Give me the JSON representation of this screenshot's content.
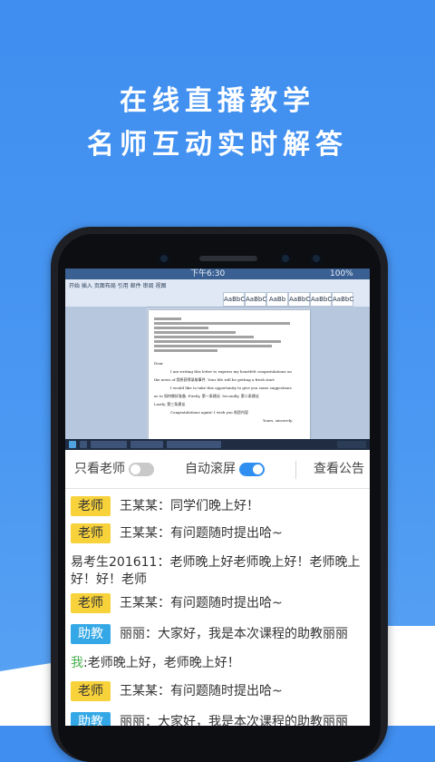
{
  "headline": {
    "line1": "在线直播教学",
    "line2": "名师互动实时解答"
  },
  "video": {
    "status_time": "下午6:30",
    "status_battery": "100%",
    "ribbon_tabs": "开始  插入  页面布局  引用  邮件  审阅  视图",
    "styles": [
      "AaBbCcI",
      "AaBbCcI",
      "AaBb",
      "AaBbC",
      "AaBbC",
      "AaBbC"
    ],
    "doc_text": {
      "dear": "Dear",
      "p1": "I am writing this letter to express my heartfelt congratulations on",
      "p2": "the news of 我所获得录取事件. Your life will be getting a fresh start",
      "p3": "I would like to take this opportunity to give you some suggestions",
      "p4": "as to 如何做好准备. Firstly, 第一条建议. Secondly, 第二条建议",
      "p5": "Lastly, 第三条建议.",
      "p6": "Congratulations again! I wish you 祝愿内容",
      "sign": "Yours, sincerely,"
    }
  },
  "controls": {
    "teacher_only_label": "只看老师",
    "teacher_only_on": false,
    "autoscroll_label": "自动滚屏",
    "autoscroll_on": true,
    "notice_label": "查看公告"
  },
  "chat": {
    "messages": [
      {
        "badge": "老师",
        "badge_type": "teacher",
        "text": "王某某：同学们晚上好！"
      },
      {
        "badge": "老师",
        "badge_type": "teacher",
        "text": "王某某：有问题随时提出哈~"
      },
      {
        "badge": "",
        "badge_type": "none",
        "text": "易考生201611：老师晚上好老师晚上好！老师晚上好！好！老师"
      },
      {
        "badge": "老师",
        "badge_type": "teacher",
        "text": "王某某：有问题随时提出哈~"
      },
      {
        "badge": "助教",
        "badge_type": "assistant",
        "text": "丽丽：大家好，我是本次课程的助教丽丽"
      },
      {
        "badge": "",
        "badge_type": "me",
        "me_label": "我",
        "text": ":老师晚上好，老师晚上好！"
      },
      {
        "badge": "老师",
        "badge_type": "teacher",
        "text": "王某某：有问题随时提出哈~"
      },
      {
        "badge": "助教",
        "badge_type": "assistant",
        "text": "丽丽：大家好，我是本次课程的助教丽丽"
      }
    ]
  },
  "colors": {
    "background": "#4a98f2",
    "teacher_badge": "#f7d23b",
    "assistant_badge": "#34a8e6",
    "toggle_on": "#2f8ff0",
    "me_label": "#4caf50"
  }
}
